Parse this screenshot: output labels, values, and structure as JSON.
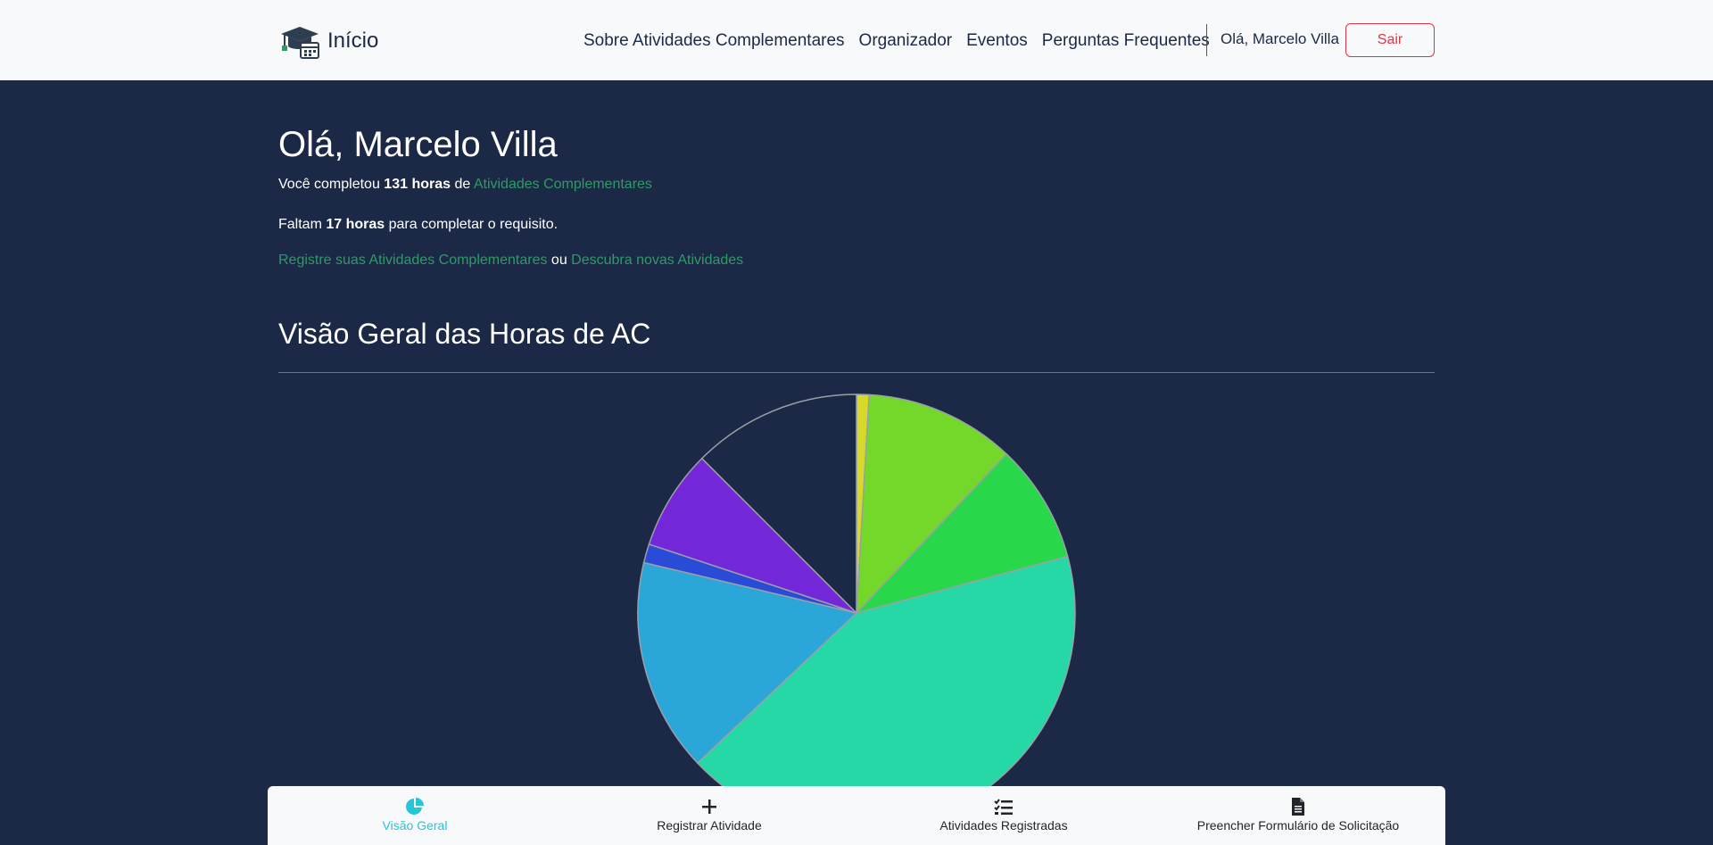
{
  "navbar": {
    "brand": "Início",
    "links": [
      "Sobre Atividades Complementares",
      "Organizador",
      "Eventos",
      "Perguntas Frequentes"
    ],
    "greeting": "Olá, Marcelo Villa",
    "logout": "Sair"
  },
  "main": {
    "hello": "Olá, Marcelo Villa",
    "completed_prefix": "Você completou ",
    "completed_hours": "131 horas",
    "completed_mid": " de ",
    "completed_link": "Atividades Complementares",
    "remaining_prefix": "Faltam ",
    "remaining_hours": "17 horas",
    "remaining_suffix": " para completar o requisito.",
    "register_link": "Registre suas Atividades Complementares",
    "or": " ou ",
    "discover_link": "Descubra novas Atividades",
    "section_title": "Visão Geral das Horas de AC"
  },
  "chart_data": {
    "type": "pie",
    "title": "",
    "values": [
      2,
      24,
      19,
      91,
      34,
      3,
      16,
      27
    ],
    "colors": [
      "#d6d82a",
      "#74d82a",
      "#28d84a",
      "#27d8a7",
      "#2aa7d8",
      "#2a4ad8",
      "#7427d8",
      "#1b2947"
    ],
    "stroke": "#9aa0a6"
  },
  "bottom_nav": [
    {
      "label": "Visão Geral",
      "icon": "pie-chart-icon",
      "active": true
    },
    {
      "label": "Registrar Atividade",
      "icon": "plus-icon",
      "active": false
    },
    {
      "label": "Atividades Registradas",
      "icon": "checklist-icon",
      "active": false
    },
    {
      "label": "Preencher Formulário de Solicitação",
      "icon": "document-icon",
      "active": false
    }
  ],
  "colors": {
    "background": "#1b2947",
    "accent_green": "#2f9a66",
    "danger": "#dc3545",
    "active_tab": "#26c6da"
  }
}
